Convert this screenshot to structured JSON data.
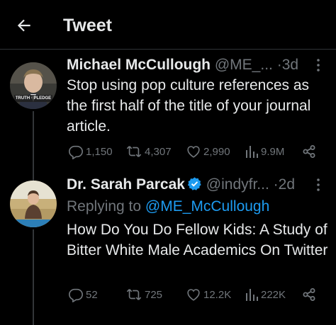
{
  "header": {
    "title": "Tweet",
    "back_icon": "arrow-left-icon"
  },
  "colors": {
    "background": "#000000",
    "text_primary": "#e7e9ea",
    "text_secondary": "#71767b",
    "link_blue": "#1d9bf0",
    "divider": "#2f3336"
  },
  "tweets": [
    {
      "name": "Michael McCullough",
      "handle": "@ME_...",
      "separator": "·",
      "time": "3d",
      "text": "Stop using pop culture references as the first half of the title of your journal article.",
      "avatar_caption": "TRUTH · PLEDGE",
      "actions": {
        "replies": "1,150",
        "retweets": "4,307",
        "likes": "2,990",
        "views": "9.9M"
      }
    },
    {
      "name": "Dr. Sarah Parcak",
      "verified": true,
      "handle": "@indyfr...",
      "separator": "·",
      "time": "2d",
      "replying_prefix": "Replying to",
      "replying_to": "@ME_McCullough",
      "text": "How Do You Do Fellow Kids: A Study of Bitter White Male Academics On Twitter",
      "actions": {
        "replies": "52",
        "retweets": "725",
        "likes": "12.2K",
        "views": "222K"
      }
    }
  ]
}
